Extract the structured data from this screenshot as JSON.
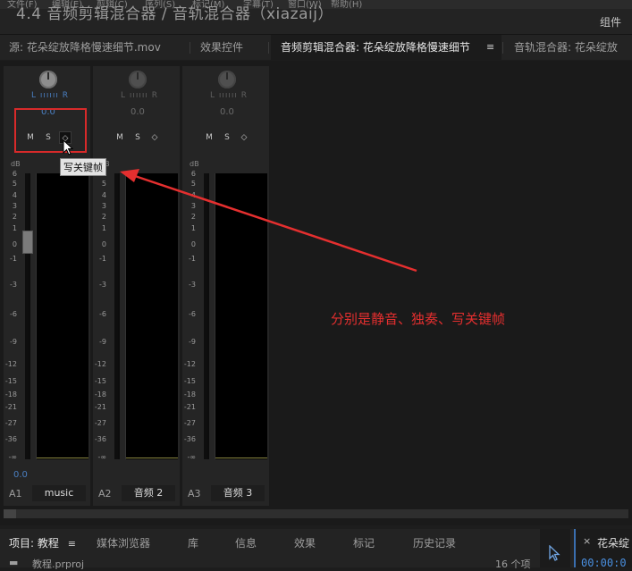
{
  "overlay_title": "4.4 音频剪辑混合器 / 音轨混合器（xiazaij）",
  "menubar": [
    "文件(F)",
    "编辑(E)",
    "剪辑(C)",
    "序列(S)",
    "标记(M)",
    "字幕(T)",
    "窗口(W)",
    "帮助(H)"
  ],
  "workspace": {
    "label": "组件"
  },
  "tabs": [
    {
      "label": "源: 花朵绽放降格慢速细节.mov"
    },
    {
      "label": "效果控件"
    },
    {
      "label": "音频剪辑混合器: 花朵绽放降格慢速细节",
      "menu": "≡"
    },
    {
      "label": "音轨混合器: 花朵绽放"
    }
  ],
  "mixer": {
    "db_label": "dB",
    "scale": [
      "6",
      "5",
      "4",
      "3",
      "2",
      "1",
      "0",
      "-1",
      "-3",
      "-6",
      "-9",
      "-12",
      "-15",
      "-18",
      "-21",
      "-27",
      "-36",
      "-∞"
    ],
    "channels": [
      {
        "id": "A1",
        "name": "music",
        "pan_lr": "L ıııııı R",
        "pan_value": "0.0",
        "mute": "M",
        "solo": "S",
        "keyframe": "◇",
        "volume": "0.0",
        "active": true
      },
      {
        "id": "A2",
        "name": "音频 2",
        "pan_lr": "L ıııııı R",
        "pan_value": "0.0",
        "mute": "M",
        "solo": "S",
        "keyframe": "◇",
        "active": false
      },
      {
        "id": "A3",
        "name": "音频 3",
        "pan_lr": "L ıııııı R",
        "pan_value": "0.0",
        "mute": "M",
        "solo": "S",
        "keyframe": "◇",
        "active": false
      }
    ]
  },
  "tooltip": "写关键帧",
  "annotation": "分别是静音、独奏、写关键帧",
  "bottom_tabs": [
    {
      "label": "项目: 教程",
      "menu": "≡"
    },
    {
      "label": "媒体浏览器"
    },
    {
      "label": "库"
    },
    {
      "label": "信息"
    },
    {
      "label": "效果"
    },
    {
      "label": "标记"
    },
    {
      "label": "历史记录"
    }
  ],
  "project": {
    "file": "教程.prproj",
    "count": "16 个项"
  },
  "right_panel": {
    "tab": "花朵绽",
    "close": "×",
    "timecode": "00:00:0"
  },
  "colors": {
    "accent_blue": "#4a7fc1",
    "annotation_red": "#e52f2f",
    "meter_line": "#8b8742"
  }
}
